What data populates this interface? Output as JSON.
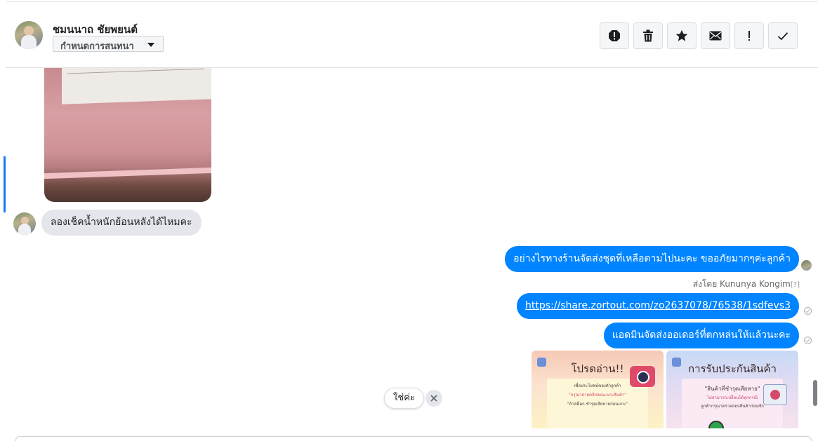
{
  "header": {
    "contact_name": "ชมนนาถ ชัยพยนต์",
    "assign_label": "กำหนดการสนทนา"
  },
  "toolbar": {
    "icons": [
      "spam-icon",
      "trash-icon",
      "star-icon",
      "envelope-icon",
      "follow-up-icon",
      "checkmark-icon"
    ]
  },
  "messages": {
    "incoming_text": "ลองเช็คน้ำหนักย้อนหลังได้ไหมคะ",
    "outgoing_apology": "อย่างไรทางร้านจัดส่งชุดที่เหลือตามไปนะคะ ขออภัยมากๆค่ะลูกค้า",
    "sent_by_label": "ส่งโดย Kununya Kongim",
    "help_mark": "[?]",
    "tracking_link": "https://share.zortout.com/zo2637078/76538/1sdfevs3",
    "outgoing_shipped": "แอดมินจัดส่งออเดอร์ที่ตกหล่นให้แล้วนะคะ"
  },
  "cards": [
    {
      "title": "โปรดอ่าน!!",
      "lines": [
        "เพื่อประโยชน์ของตัวลูกค้า",
        "\"กรุณาถ่ายคลิปขณะแกะสินค้า\"",
        "\"ถ้าสต็อก ชำรุดเสียหายก่อนแกะ\""
      ]
    },
    {
      "title": "การรับประกันสินค้า",
      "lines": [
        "\"สินค้าที่ชำรุดเสียหาย\"",
        "ไม่สามารถเปลี่ยนได้ทุกกรณี",
        "ลูกค้ากรุณาตรวจสอบสินค้าก่อนซัก"
      ]
    }
  ],
  "suggestion": {
    "label": "ใช่ค่ะ"
  },
  "colors": {
    "outgoing_bubble": "#0084ff",
    "incoming_bubble": "#e4e6eb",
    "accent": "#1877f2"
  }
}
